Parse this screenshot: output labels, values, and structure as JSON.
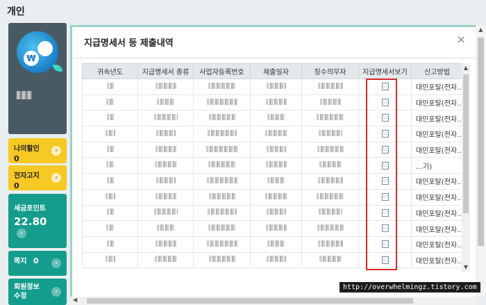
{
  "page": {
    "title": "개인"
  },
  "sidebar": {
    "coin_symbol": "₩",
    "deduction": {
      "label": "나의할인",
      "value": "0"
    },
    "e_notice": {
      "label": "전자고지",
      "value": "0"
    },
    "tax_points": {
      "label": "세금포인트",
      "value": "22.80"
    },
    "messages": {
      "label": "쪽지",
      "value": "0"
    },
    "member_info": {
      "label": "회원정보 수정"
    }
  },
  "modal": {
    "title": "지급명세서 등 제출내역",
    "close_label": "×",
    "columns": [
      "귀속년도",
      "지급명세서 종류",
      "사업자등록번호",
      "제출일자",
      "징수의무자",
      "지급명세서보기",
      "신고방법"
    ],
    "rows": [
      {
        "method": "대민포탈(전자…"
      },
      {
        "method": "대민포탈(전자…"
      },
      {
        "method": "대민포탈(전자…"
      },
      {
        "method": "대민포탈(전자…"
      },
      {
        "method": "대민포탈(전자…"
      },
      {
        "method": "…기)"
      },
      {
        "method": "대민포탈(전자…"
      },
      {
        "method": "대민포탈(전자…"
      },
      {
        "method": "대민포탈(전자…"
      },
      {
        "method": "대민포탈(전자…"
      },
      {
        "method": "대민포탈(전자…"
      },
      {
        "method": "대민포탈(전자…"
      }
    ]
  },
  "watermark": "http://overwhelmingz.tistory.com",
  "colors": {
    "accent_teal": "#149c8c",
    "accent_yellow": "#f7c924",
    "highlight_red": "#d42a2a"
  }
}
